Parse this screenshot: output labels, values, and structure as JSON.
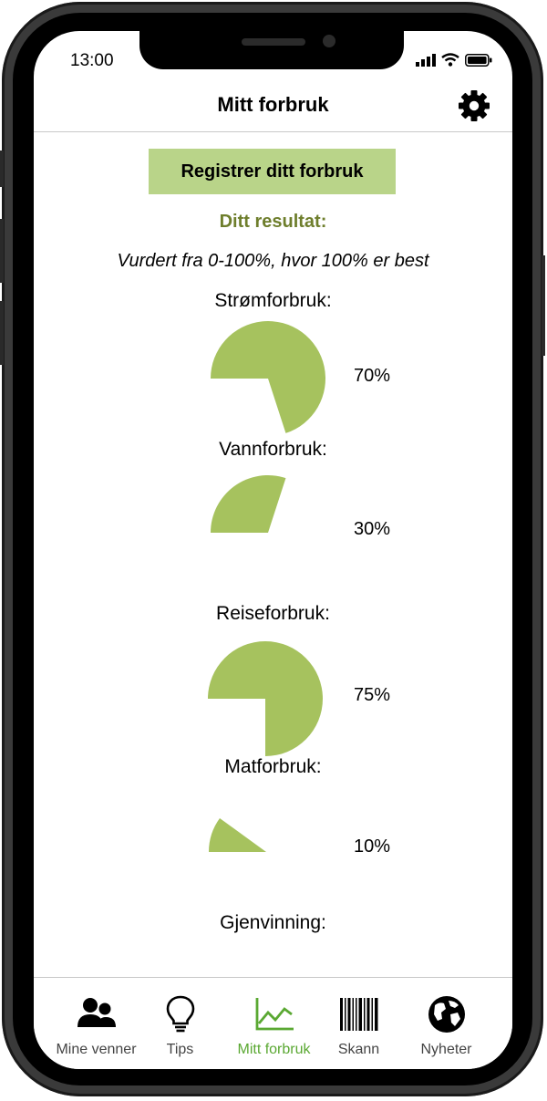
{
  "status": {
    "time": "13:00"
  },
  "header": {
    "title": "Mitt forbruk"
  },
  "register_button": "Registrer ditt forbruk",
  "result_title": "Ditt resultat:",
  "scale_note": "Vurdert fra 0-100%, hvor 100% er best",
  "categories": [
    {
      "label": "Strømforbruk:",
      "percent_label": "70%",
      "value": 70
    },
    {
      "label": "Vannforbruk:",
      "percent_label": "30%",
      "value": 30
    },
    {
      "label": "Reiseforbruk:",
      "percent_label": "75%",
      "value": 75
    },
    {
      "label": "Matforbruk:",
      "percent_label": "10%",
      "value": 10
    },
    {
      "label": "Gjenvinning:"
    }
  ],
  "tabs": [
    {
      "label": "Mine venner",
      "icon": "friends-icon"
    },
    {
      "label": "Tips",
      "icon": "lightbulb-icon"
    },
    {
      "label": "Mitt forbruk",
      "icon": "chart-icon",
      "active": true
    },
    {
      "label": "Skann",
      "icon": "barcode-icon"
    },
    {
      "label": "Nyheter",
      "icon": "globe-icon"
    }
  ],
  "colors": {
    "accent_green": "#a6c25e",
    "button_green": "#b9d489",
    "title_olive": "#6e7e2c",
    "active_tab": "#5aa832"
  }
}
